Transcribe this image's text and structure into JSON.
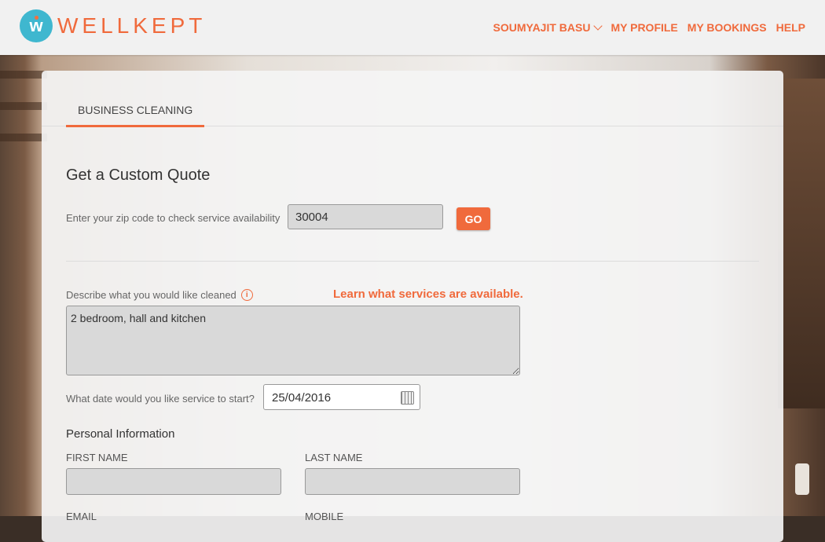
{
  "brand": {
    "name": "WELLKEPT",
    "logo_icon": "w-logo-icon"
  },
  "nav": {
    "user": "SOUMYAJIT BASU",
    "profile": "MY PROFILE",
    "bookings": "MY BOOKINGS",
    "help": "HELP"
  },
  "tabs": [
    {
      "label": "BUSINESS CLEANING",
      "active": true
    }
  ],
  "quote": {
    "title": "Get a Custom Quote",
    "zip_label": "Enter your zip code to check service availability",
    "zip_value": "30004",
    "go_label": "GO"
  },
  "describe": {
    "label": "Describe what you would like cleaned",
    "info_icon": "i",
    "learn_link": "Learn what services are available.",
    "value": "2 bedroom, hall and kitchen"
  },
  "date": {
    "label": "What date would you like service to start?",
    "value": "25/04/2016"
  },
  "personal": {
    "heading": "Personal Information",
    "first_name_label": "FIRST NAME",
    "first_name_value": "",
    "last_name_label": "LAST NAME",
    "last_name_value": "",
    "email_label": "EMAIL",
    "mobile_label": "MOBILE"
  },
  "colors": {
    "accent": "#f06a3c",
    "logo": "#3fb7cf"
  }
}
